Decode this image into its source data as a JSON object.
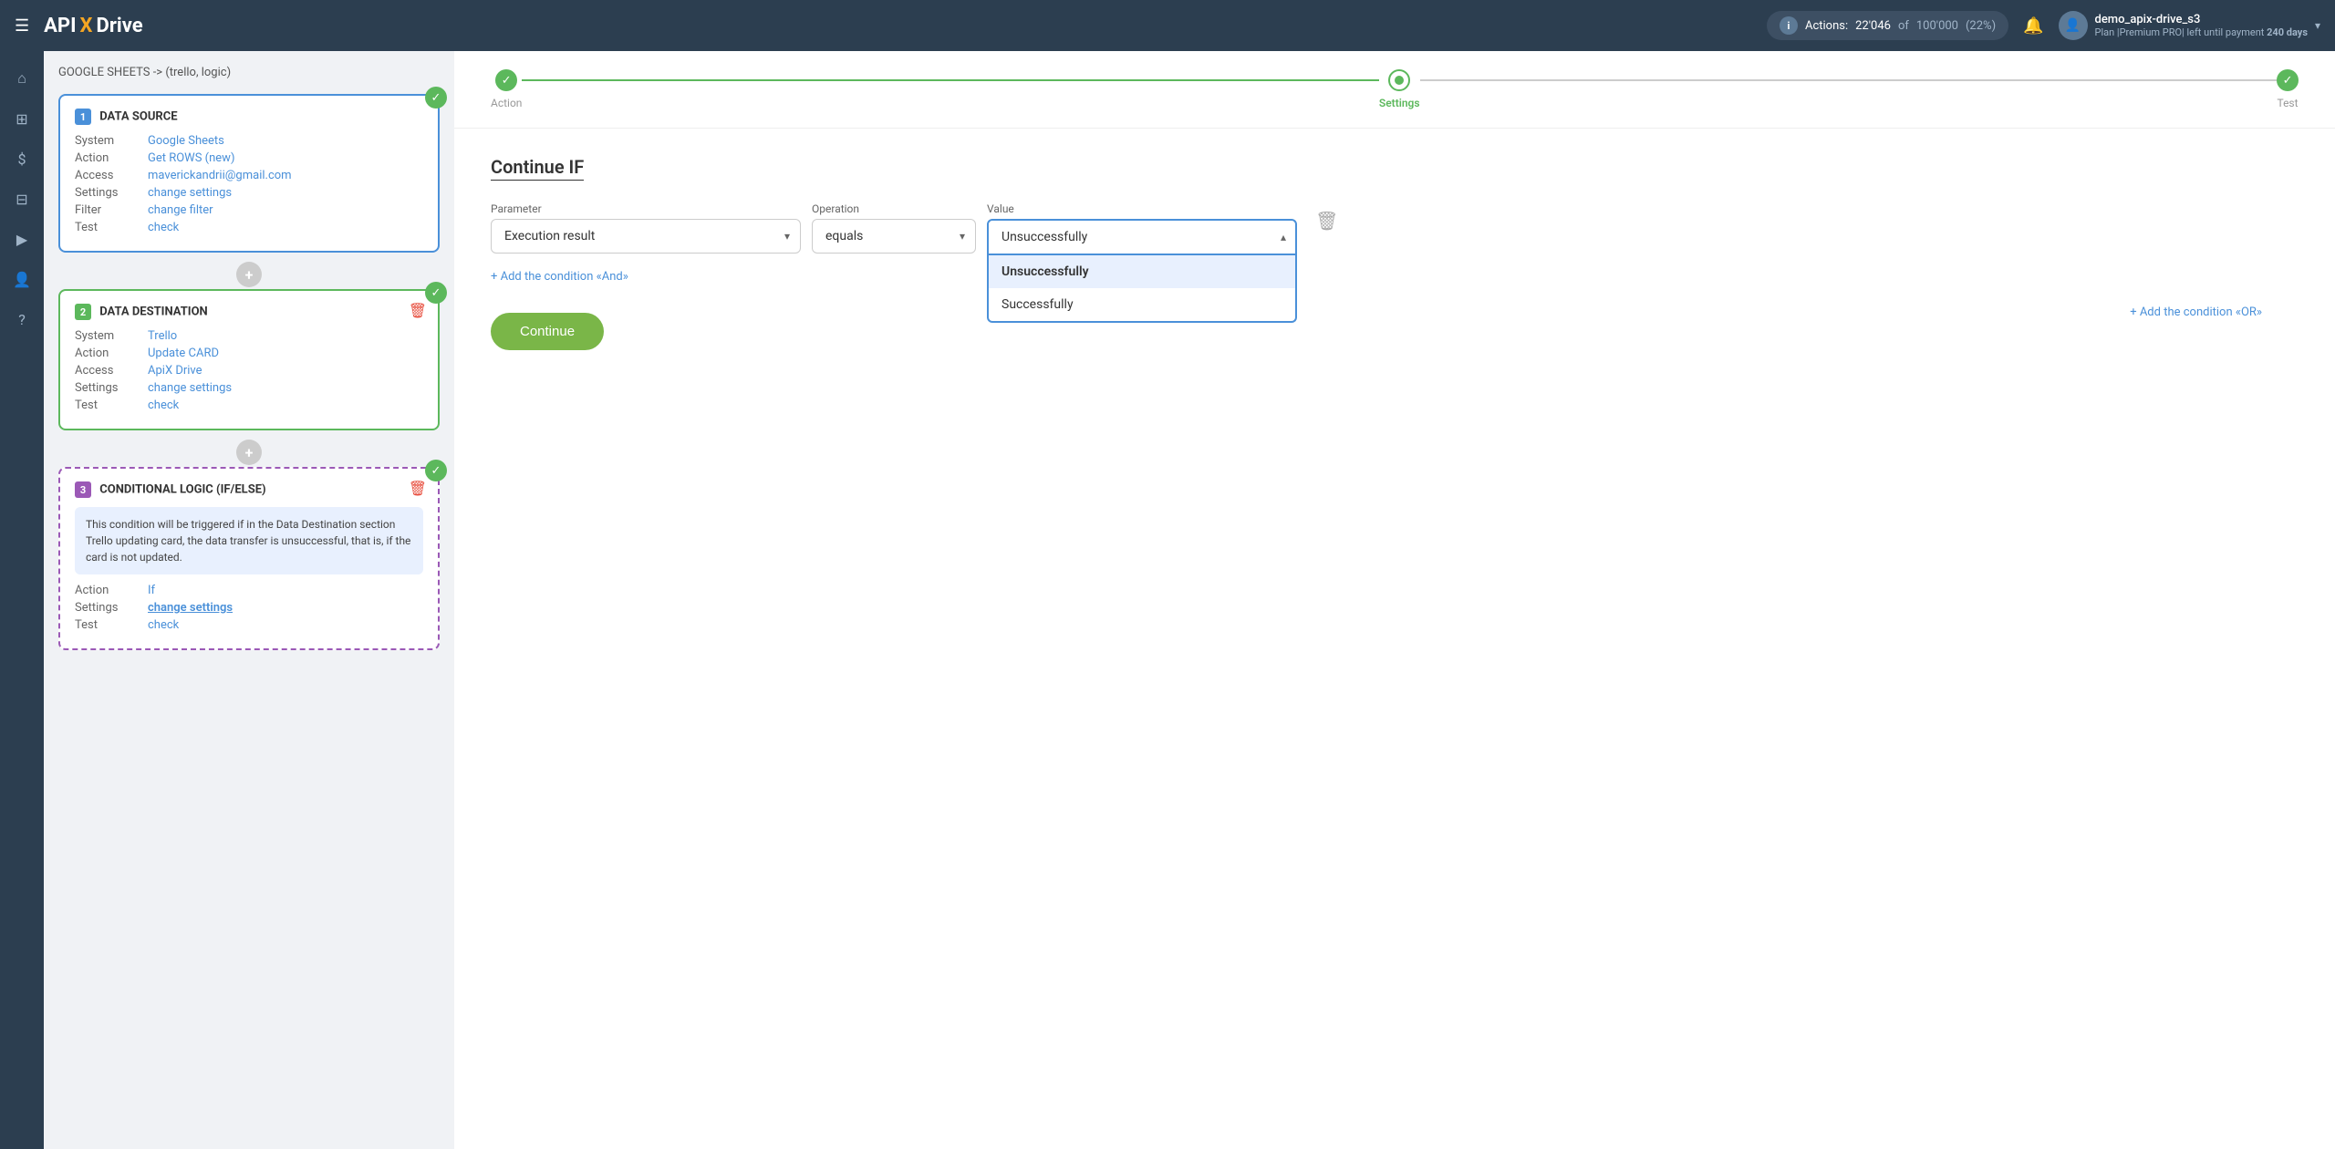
{
  "topnav": {
    "logo": {
      "api": "API",
      "x": "X",
      "drive": "Drive"
    },
    "hamburger": "☰",
    "actions_label": "Actions:",
    "actions_count": "22'046",
    "actions_of": "of",
    "actions_total": "100'000",
    "actions_pct": "(22%)",
    "bell": "🔔",
    "user_icon": "👤",
    "user_name": "demo_apix-drive_s3",
    "user_plan": "Plan |Premium PRO| left until payment",
    "user_days": "240 days",
    "chevron": "▾",
    "info": "i"
  },
  "sidebar": {
    "icons": [
      {
        "name": "home-icon",
        "symbol": "⌂"
      },
      {
        "name": "flow-icon",
        "symbol": "⊞"
      },
      {
        "name": "billing-icon",
        "symbol": "$"
      },
      {
        "name": "briefcase-icon",
        "symbol": "⊟"
      },
      {
        "name": "video-icon",
        "symbol": "▶"
      },
      {
        "name": "user-icon",
        "symbol": "👤"
      },
      {
        "name": "help-icon",
        "symbol": "?"
      }
    ]
  },
  "left_panel": {
    "breadcrumb": "GOOGLE SHEETS -> (trello, logic)",
    "cards": [
      {
        "id": 1,
        "num": "1",
        "title": "DATA SOURCE",
        "type": "blue",
        "has_check": true,
        "has_trash": false,
        "rows": [
          {
            "label": "System",
            "value": "Google Sheets"
          },
          {
            "label": "Action",
            "value": "Get ROWS (new)"
          },
          {
            "label": "Access",
            "value": "maverickandrii@gmail.com"
          },
          {
            "label": "Settings",
            "value": "change settings"
          },
          {
            "label": "Filter",
            "value": "change filter"
          },
          {
            "label": "Test",
            "value": "check"
          }
        ]
      },
      {
        "id": 2,
        "num": "2",
        "title": "DATA DESTINATION",
        "type": "green",
        "has_check": true,
        "has_trash": true,
        "rows": [
          {
            "label": "System",
            "value": "Trello"
          },
          {
            "label": "Action",
            "value": "Update CARD"
          },
          {
            "label": "Access",
            "value": "ApiX Drive"
          },
          {
            "label": "Settings",
            "value": "change settings"
          },
          {
            "label": "Test",
            "value": "check"
          }
        ]
      },
      {
        "id": 3,
        "num": "3",
        "title": "CONDITIONAL LOGIC (IF/ELSE)",
        "type": "purple",
        "has_check": true,
        "has_trash": true,
        "description": "This condition will be triggered if in the Data Destination section Trello updating card, the data transfer is unsuccessful, that is, if the card is not updated.",
        "rows": [
          {
            "label": "Action",
            "value": "If"
          },
          {
            "label": "Settings",
            "value": "change settings",
            "underline": true
          },
          {
            "label": "Test",
            "value": "check"
          }
        ]
      }
    ]
  },
  "right_panel": {
    "steps": [
      {
        "label": "Action",
        "state": "done"
      },
      {
        "label": "Settings",
        "state": "active"
      },
      {
        "label": "Test",
        "state": "done"
      }
    ],
    "page_title": "Continue IF",
    "form": {
      "parameter_label": "Parameter",
      "parameter_value": "Execution result",
      "operation_label": "Operation",
      "operation_value": "equals",
      "value_label": "Value",
      "value_selected": "Unsuccessfully",
      "dropdown_options": [
        {
          "value": "Unsuccessfully",
          "selected": true
        },
        {
          "value": "Successfully",
          "selected": false
        }
      ]
    },
    "add_condition_label": "+ Add the condition «And»",
    "add_or_label": "+ Add the condition «OR»",
    "continue_button": "Continue",
    "delete_icon": "🗑"
  }
}
